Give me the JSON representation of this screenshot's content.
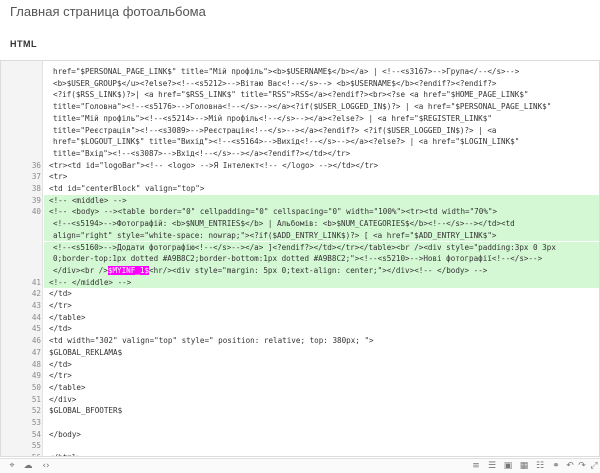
{
  "page": {
    "title": "Главная страница фотоальбома",
    "section_label": "HTML"
  },
  "editor": {
    "continuation_lines": [
      "href=\"$PERSONAL_PAGE_LINK$\" title=\"Мій профіль\"><b>$USERNAME$</b></a> | <!--<s3167>-->Група</--</s>-->",
      "<b>$USER_GROUP$</u><?else?><!--<s5212>-->Вітаю Вас<!--</s>--> <b>$USERNAME$</b><?endif?><?endif?>",
      "<?if($RSS_LINK$)?>| <a href=\"$RSS_LINK$\" title=\"RSS\">RSS</a><?endif?><br><?se <a href=\"$HOME_PAGE_LINK$\"",
      "title=\"Головна\"><!--<s5176>-->Головна<!--</s>--></a><?if($USER_LOGGED_IN$)?> | <a href=\"$PERSONAL_PAGE_LINK$\"",
      "title=\"Мій профіль\"><!--<s5214>-->Мій профіль<!--</s>--></a><?else?> | <a href=\"$REGISTER_LINK$\"",
      "title=\"Реєстрація\"><!--<s3089>-->Реєстрація<!--</s>--></a><?endif?> <?if($USER_LOGGED_IN$)?> | <a",
      "href=\"$LOGOUT_LINK$\" title=\"Вихід\"><!--<s5164>-->Вихід<!--</s>--></a><?else?> | <a href=\"$LOGIN_LINK$\"",
      "title=\"Вхід\"><!--<s3087>-->Вхід<!--</s>--></a><?endif?></td></tr>"
    ],
    "lines": [
      {
        "num": "36",
        "text": "<tr><td id=\"logoBar\"><!-- <logo> -->Я Інтелект<!-- </logo> --></td></tr>"
      },
      {
        "num": "37",
        "text": "<tr>"
      },
      {
        "num": "38",
        "text": "<td id=\"centerBlock\" valign=\"top\">"
      },
      {
        "num": "39",
        "text": "<!-- <middle> -->"
      },
      {
        "num": "40",
        "text": "<!-- <body> --><table border=\"0\" cellpadding=\"0\" cellspacing=\"0\" width=\"100%\"><tr><td width=\"70%\">"
      },
      {
        "num": "",
        "text": "<!--<s5194>-->Фотографій: <b>$NUM_ENTRIES$</b> | Альбомів: <b>$NUM_CATEGORIES$</b><!--</s>--></td><td"
      },
      {
        "num": "",
        "text": "align=\"right\" style=\"white-space: nowrap;\"><?if($ADD_ENTRY_LINK$)?> [ <a href=\"$ADD_ENTRY_LINK$\">"
      },
      {
        "num": "",
        "text": "<!--<s5160>-->Додати фотографію<!--</s>--></a> ]<?endif?></td></tr></table><br /><div style=\"padding:3px 0 3px"
      },
      {
        "num": "",
        "text": "0;border-top:1px dotted #A9B8C2;border-bottom:1px dotted #A9B8C2;\"><!--<s5210>-->Нові фотографії<!--</s>-->"
      },
      {
        "num": "",
        "text": "</div><br />$MYINF_1$<hr/><div style=\"margin: 5px 0;text-align: center;\"></div><!-- </body> -->"
      },
      {
        "num": "41",
        "text": "<!-- </middle> -->"
      },
      {
        "num": "42",
        "text": "</td>"
      },
      {
        "num": "43",
        "text": "</tr>"
      },
      {
        "num": "44",
        "text": "</table>"
      },
      {
        "num": "45",
        "text": "</td>"
      },
      {
        "num": "46",
        "text": "<td width=\"302\" valign=\"top\" style=\" position: relative; top: 380px; \">"
      },
      {
        "num": "47",
        "text": "$GLOBAL_REKLAMA$"
      },
      {
        "num": "48",
        "text": "</td>"
      },
      {
        "num": "49",
        "text": "</tr>"
      },
      {
        "num": "50",
        "text": "</table>"
      },
      {
        "num": "51",
        "text": "</div>"
      },
      {
        "num": "52",
        "text": "$GLOBAL_BFOOTER$"
      },
      {
        "num": "53",
        "text": ""
      },
      {
        "num": "54",
        "text": "</body>"
      },
      {
        "num": "55",
        "text": ""
      },
      {
        "num": "56",
        "text": "</html>"
      }
    ],
    "highlight_token": "$MYINF_1$"
  },
  "toolbar_left": [
    {
      "icon": "cursor-icon"
    },
    {
      "icon": "cloud-icon"
    },
    {
      "icon": "bracket-icon"
    }
  ],
  "toolbar_right": [
    {
      "icon": "list-icon"
    },
    {
      "icon": "ordered-list-icon"
    },
    {
      "icon": "image-icon"
    },
    {
      "icon": "table-icon"
    },
    {
      "icon": "align-icon"
    },
    {
      "icon": "link-icon"
    },
    {
      "icon": "undo-icon"
    },
    {
      "icon": "redo-icon"
    },
    {
      "icon": "fullscreen-icon"
    }
  ],
  "colors": {
    "highlight_bg": "#d4f7d4",
    "marker_bg": "#ff00ff",
    "tag": "#1a1a9a",
    "attr": "#6b8e23",
    "string": "#2255cc",
    "comment": "#b05500"
  }
}
